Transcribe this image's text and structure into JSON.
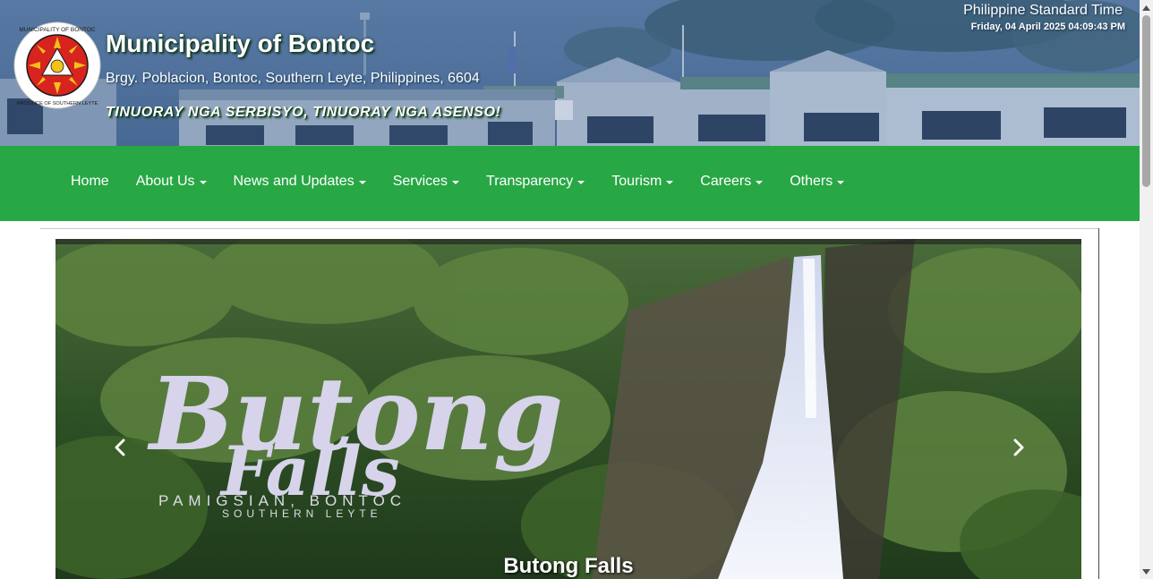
{
  "header": {
    "title": "Municipality of Bontoc",
    "address": "Brgy. Poblacion, Bontoc, Southern Leyte, Philippines, 6604",
    "motto": "TINUORAY NGA SERBISYO, TINUORAY NGA ASENSO!",
    "seal": {
      "icon": "municipal-seal-icon",
      "ring_top_text": "MUNICIPALITY OF BONTOC",
      "ring_bottom_text": "PROVINCE OF SOUTHERN LEYTE"
    },
    "time": {
      "label": "Philippine Standard Time",
      "value": "Friday, 04 April 2025 04:09:43 PM"
    }
  },
  "nav": {
    "items": [
      {
        "label": "Home",
        "dropdown": false
      },
      {
        "label": "About Us",
        "dropdown": true
      },
      {
        "label": "News and Updates",
        "dropdown": true
      },
      {
        "label": "Services",
        "dropdown": true
      },
      {
        "label": "Transparency",
        "dropdown": true
      },
      {
        "label": "Tourism",
        "dropdown": true
      },
      {
        "label": "Careers",
        "dropdown": true
      },
      {
        "label": "Others",
        "dropdown": true
      }
    ]
  },
  "carousel": {
    "slide": {
      "logo_line1": "Butong",
      "logo_line2": "Falls",
      "sub_line1": "PAMIGSIAN, BONTOC",
      "sub_line2": "SOUTHERN LEYTE",
      "caption": "Butong Falls"
    },
    "prev_icon": "chevron-left-icon",
    "next_icon": "chevron-right-icon"
  },
  "colors": {
    "nav_green": "#28a745",
    "header_blue": "#56779e",
    "forest_green": "#2f5a26"
  }
}
